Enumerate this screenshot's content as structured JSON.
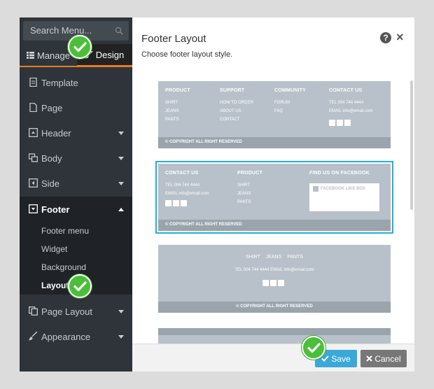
{
  "sidebar": {
    "search_placeholder": "Search Menu...",
    "tabs": {
      "manage": "Manage",
      "design": "Design"
    },
    "items": [
      {
        "label": "Template",
        "icon": "file-icon"
      },
      {
        "label": "Page",
        "icon": "page-icon"
      },
      {
        "label": "Header",
        "icon": "header-icon"
      },
      {
        "label": "Body",
        "icon": "body-icon"
      },
      {
        "label": "Side",
        "icon": "side-icon"
      },
      {
        "label": "Footer",
        "icon": "footer-icon"
      },
      {
        "label": "Page Layout",
        "icon": "copy-icon"
      },
      {
        "label": "Appearance",
        "icon": "brush-icon"
      }
    ],
    "footer_submenu": [
      "Footer menu",
      "Widget",
      "Background",
      "Layout"
    ]
  },
  "panel": {
    "title": "Footer Layout",
    "subtitle": "Choose footer layout style.",
    "help": "?",
    "close": "×",
    "save_label": "Save",
    "cancel_label": "Cancel"
  },
  "layouts": {
    "one": {
      "columns": [
        {
          "title": "PRODUCT",
          "lines": [
            "SHIRT",
            "JEANS",
            "PANTS"
          ]
        },
        {
          "title": "SUPPORT",
          "lines": [
            "HOW TO ORDER",
            "ABOUT US",
            "CONTACT"
          ]
        },
        {
          "title": "COMMUNITY",
          "lines": [
            "FORUM",
            "FAQ"
          ]
        },
        {
          "title": "CONTACT US",
          "lines": [
            "TEL 004 744 4444",
            "EMAIL info@email.com"
          ]
        }
      ],
      "copyright": "© COPYRIGHT ALL RIGHT RESERVED"
    },
    "two": {
      "columns": [
        {
          "title": "CONTACT US",
          "lines": [
            "TEL 004 744 4444",
            "EMAIL info@email.com"
          ]
        },
        {
          "title": "PRODUCT",
          "lines": [
            "SHIRT",
            "JEANS",
            "PANTS"
          ]
        },
        {
          "title": "FIND US ON FACEBOOK",
          "lines": []
        }
      ],
      "facebook_box": "FACEBOOK LIKE BOX",
      "copyright": "© COPYRIGHT ALL RIGHT RESERVED"
    },
    "three": {
      "links": [
        "SHIRT",
        "JEANS",
        "PANTS"
      ],
      "contact": "TEL 004 744 4444   EMAIL info@email.com",
      "copyright": "© COPYRIGHT ALL RIGHT RESERVED"
    }
  },
  "colors": {
    "accent": "#e67e22",
    "selected_outline": "#1eb0d8",
    "save": "#3aa8d8",
    "check_badge": "#4bbf3a"
  }
}
